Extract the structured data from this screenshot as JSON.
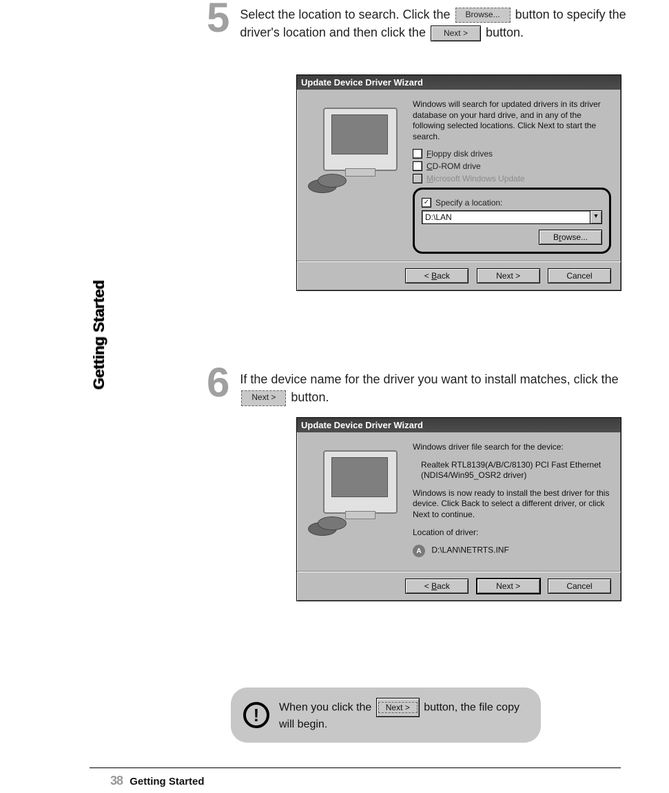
{
  "sidebar": {
    "label": "Getting Started"
  },
  "step5": {
    "number": "5",
    "text_a": "Select the location to search. Click the",
    "text_b": "button to specify the driver's location and then click the",
    "text_c": "button.",
    "inline_browse": "Browse...",
    "inline_next": "Next >"
  },
  "step6": {
    "number": "6",
    "text_a": "If the device name for the driver you want to install matches, click the",
    "text_b": "button.",
    "inline_next": "Next >"
  },
  "dialog1": {
    "title": "Update Device Driver Wizard",
    "intro": "Windows will search for updated drivers in its driver database on your hard drive, and in any of the following selected locations. Click Next to start the search.",
    "opt_floppy": "Floppy disk drives",
    "opt_cdrom": "CD-ROM drive",
    "opt_msupdate": "Microsoft Windows Update",
    "opt_specify": "Specify a location:",
    "location_value": "D:\\LAN",
    "browse": "Browse...",
    "back": "< Back",
    "next": "Next >",
    "cancel": "Cancel",
    "floppy_underline": "F",
    "cdrom_underline": "C",
    "msupdate_underline": "M",
    "browse_underline": "r",
    "back_underline": "B"
  },
  "dialog2": {
    "title": "Update Device Driver Wizard",
    "line1": "Windows driver file search for the device:",
    "device": "Realtek RTL8139(A/B/C/8130) PCI Fast Ethernet (NDIS4/Win95_OSR2 driver)",
    "line2": "Windows is now ready to install the best driver for this device. Click Back to select a different driver, or click Next to continue.",
    "loc_label": "Location of driver:",
    "loc_value": "D:\\LAN\\NETRTS.INF",
    "back": "< Back",
    "next": "Next >",
    "cancel": "Cancel",
    "back_underline": "B"
  },
  "note": {
    "text_a": "When you click the",
    "text_b": "button, the file copy will begin.",
    "inline_next": "Next >"
  },
  "footer": {
    "page": "38",
    "section": "Getting Started"
  }
}
